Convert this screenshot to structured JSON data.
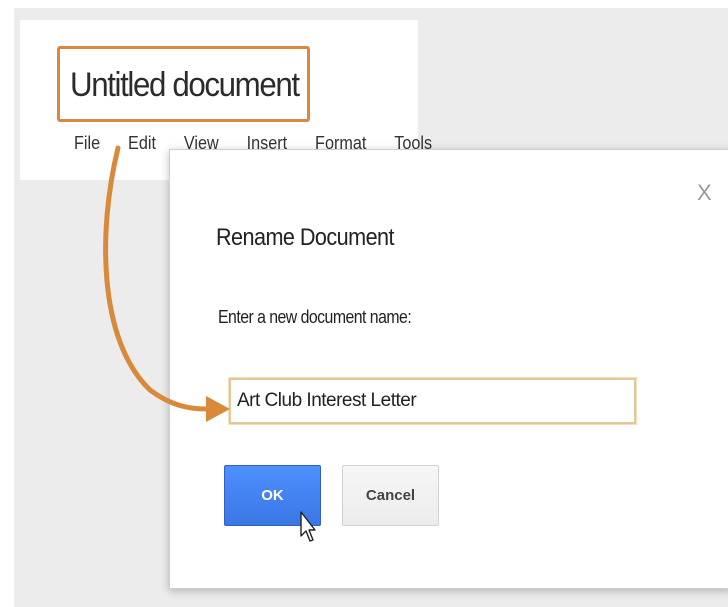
{
  "document": {
    "title": "Untitled document",
    "menu": [
      "File",
      "Edit",
      "View",
      "Insert",
      "Format",
      "Tools"
    ]
  },
  "dialog": {
    "title": "Rename Document",
    "label": "Enter a new document name:",
    "input_value": "Art Club Interest Letter",
    "ok_label": "OK",
    "cancel_label": "Cancel",
    "close_label": "X"
  },
  "colors": {
    "highlight": "#d9893a",
    "ok_button": "#4d90fe"
  },
  "icons": [
    "close-icon",
    "mouse-pointer-icon",
    "annotation-arrow"
  ]
}
